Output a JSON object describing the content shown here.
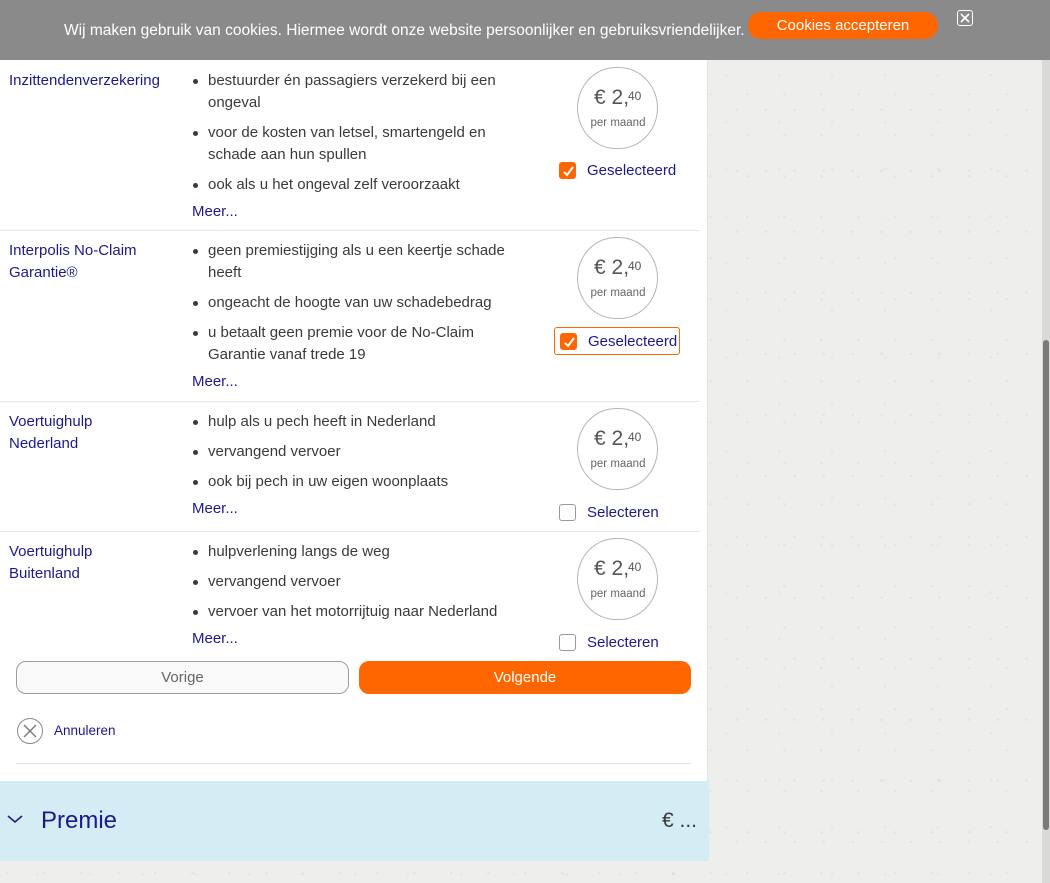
{
  "cookie_banner": {
    "text": "Wij maken gebruik van cookies. Hiermee wordt onze website persoonlijker en gebruiksvriendelijker.",
    "accept_label": "Cookies accepteren",
    "close_icon": "close-icon"
  },
  "coverages": [
    {
      "title": "Inzittendenverzekering",
      "bullets": [
        "bestuurder én passagiers verzekerd bij een ongeval",
        "voor de kosten van letsel, smartengeld en schade aan hun spullen",
        "ook als u het ongeval zelf veroorzaakt"
      ],
      "more_label": "Meer...",
      "price_main": "€ 2,",
      "price_cents": "40",
      "price_period": "per maand",
      "selected": true,
      "select_label": "Geselecteerd"
    },
    {
      "title": "Interpolis No-Claim Garantie®",
      "bullets": [
        "geen premiestijging als u een keertje schade heeft",
        "ongeacht de hoogte van uw schadebedrag",
        "u betaalt geen premie voor de No-Claim Garantie vanaf trede 19"
      ],
      "more_label": "Meer...",
      "price_main": "€ 2,",
      "price_cents": "40",
      "price_period": "per maand",
      "selected": true,
      "select_label": "Geselecteerd"
    },
    {
      "title": "Voertuighulp Nederland",
      "bullets": [
        "hulp als u pech heeft in Nederland",
        "vervangend vervoer",
        "ook bij pech in uw eigen woonplaats"
      ],
      "more_label": "Meer...",
      "price_main": "€ 2,",
      "price_cents": "40",
      "price_period": "per maand",
      "selected": false,
      "select_label": "Selecteren"
    },
    {
      "title": "Voertuighulp Buitenland",
      "bullets": [
        "hulpverlening langs de weg",
        "vervangend vervoer",
        "vervoer van het motorrijtuig naar Nederland"
      ],
      "more_label": "Meer...",
      "price_main": "€ 2,",
      "price_cents": "40",
      "price_period": "per maand",
      "selected": false,
      "select_label": "Selecteren"
    }
  ],
  "navigation": {
    "prev_label": "Vorige",
    "next_label": "Volgende",
    "cancel_label": "Annuleren",
    "cancel_icon": "close-circle-icon"
  },
  "premium": {
    "label": "Premie",
    "value": "€ ...",
    "chevron_icon": "chevron-down-icon"
  },
  "colors": {
    "accent": "#ff6600",
    "link": "#1a1a8c",
    "premium_bg": "#d4ecf4",
    "cookie_bg": "#8a8a8a"
  }
}
